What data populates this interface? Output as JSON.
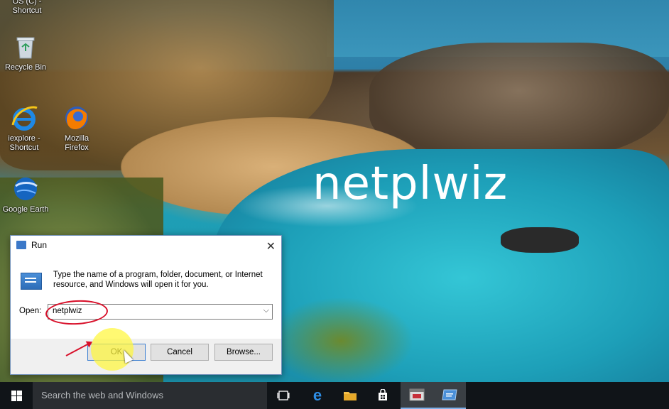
{
  "desktop": {
    "icons": [
      {
        "label": "OS (C) - Shortcut"
      },
      {
        "label": "Recycle Bin"
      },
      {
        "label": "iexplore - Shortcut"
      },
      {
        "label": "Mozilla Firefox"
      },
      {
        "label": "Google Earth"
      }
    ],
    "overlay_text": "netplwiz"
  },
  "run_dialog": {
    "title": "Run",
    "description": "Type the name of a program, folder, document, or Internet resource, and Windows will open it for you.",
    "open_label": "Open:",
    "open_value": "netplwiz",
    "buttons": {
      "ok": "OK",
      "cancel": "Cancel",
      "browse": "Browse..."
    }
  },
  "taskbar": {
    "search_placeholder": "Search the web and Windows"
  },
  "colors": {
    "accent": "#3c7fd1",
    "annotation_red": "#d8102a",
    "highlight_yellow": "#fff63c"
  }
}
